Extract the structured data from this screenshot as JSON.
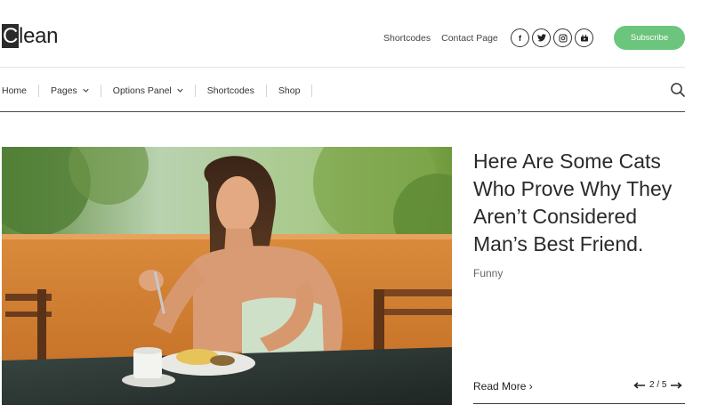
{
  "header": {
    "logo_first": "C",
    "logo_rest": "lean",
    "links": [
      "Shortcodes",
      "Contact Page"
    ],
    "socials": [
      {
        "icon": "facebook-icon",
        "glyph": "f"
      },
      {
        "icon": "twitter-icon",
        "glyph": "t"
      },
      {
        "icon": "instagram-icon",
        "glyph": "◎"
      },
      {
        "icon": "youtube-icon",
        "glyph": "▶"
      }
    ],
    "subscribe_label": "Subscribe",
    "accent": "#6cc57c"
  },
  "nav": {
    "items": [
      {
        "label": "Home",
        "dropdown": false
      },
      {
        "label": "Pages",
        "dropdown": true
      },
      {
        "label": "Options Panel",
        "dropdown": true
      },
      {
        "label": "Shortcodes",
        "dropdown": false
      },
      {
        "label": "Shop",
        "dropdown": false
      }
    ]
  },
  "featured": {
    "title": "Here Are Some Cats Who Prove Why They Aren’t Considered Man’s Best Friend.",
    "category": "Funny",
    "read_more": "Read More",
    "read_more_arrow": "›",
    "slide_indicator": "2 / 5"
  }
}
